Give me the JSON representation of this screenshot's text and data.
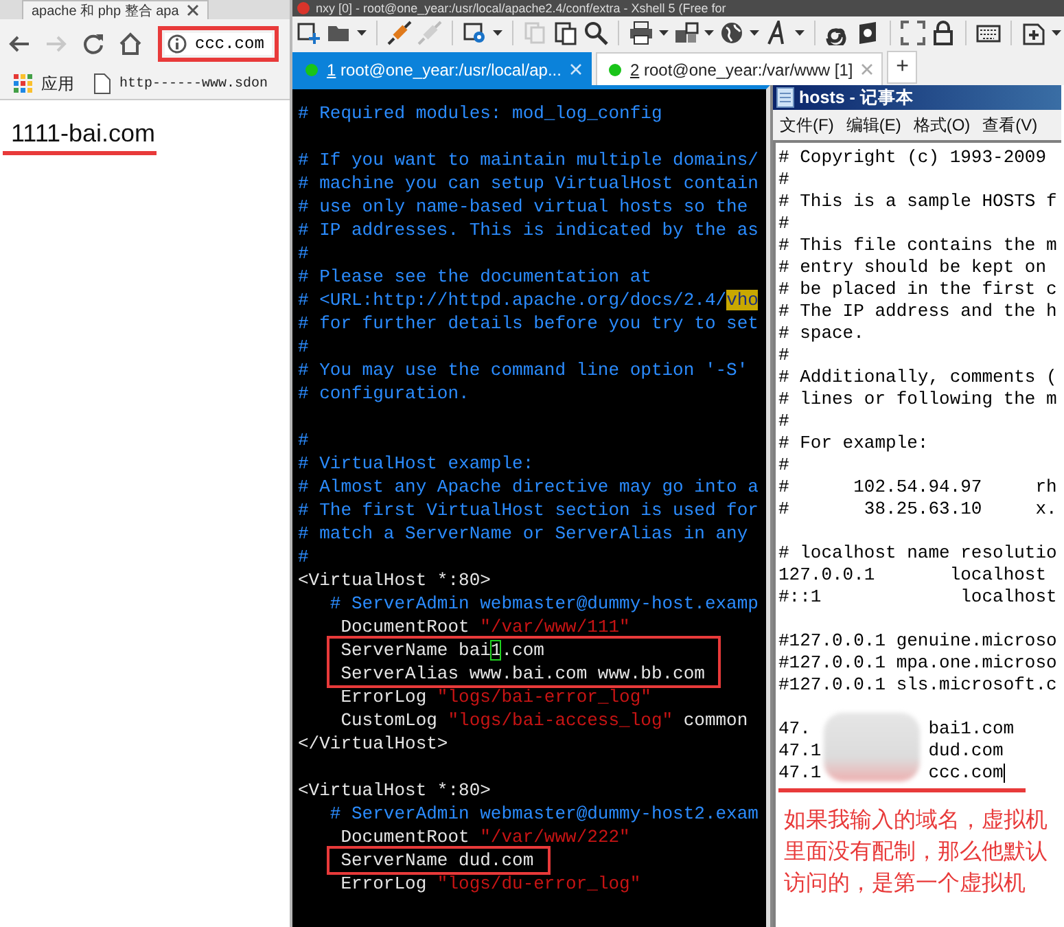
{
  "browser": {
    "tab": {
      "title": "apache 和 php 整合 apa"
    },
    "nav": [
      {
        "kind": "back",
        "disabled": false
      },
      {
        "kind": "forward",
        "disabled": true
      },
      {
        "kind": "reload",
        "disabled": false
      },
      {
        "kind": "home",
        "disabled": false
      }
    ],
    "address": {
      "value": "ccc.com"
    },
    "bookmarks": [
      {
        "kind": "apps",
        "label": "应用"
      },
      {
        "kind": "page",
        "label": "http------www.sdon"
      }
    ],
    "page_text": "1111-bai.com"
  },
  "xshell": {
    "title": "nxy [0] - root@one_year:/usr/local/apache2.4/conf/extra - Xshell 5 (Free for",
    "tabs": [
      {
        "number": "1",
        "label": " root@one_year:/usr/local/ap...",
        "selected": true
      },
      {
        "number": "2",
        "label": " root@one_year:/var/www [1]",
        "selected": false
      }
    ],
    "new_tab": "+",
    "terminal": {
      "lines": [
        {
          "kind": "text",
          "segments": [
            {
              "kind": "comment",
              "text": "# Required modules: mod_log_config"
            }
          ]
        },
        {
          "kind": "blank"
        },
        {
          "kind": "text",
          "segments": [
            {
              "kind": "comment",
              "text": "# If you want to maintain multiple domains/"
            }
          ]
        },
        {
          "kind": "text",
          "segments": [
            {
              "kind": "comment",
              "text": "# machine you can setup VirtualHost contain"
            }
          ]
        },
        {
          "kind": "text",
          "segments": [
            {
              "kind": "comment",
              "text": "# use only name-based virtual hosts so the"
            }
          ]
        },
        {
          "kind": "text",
          "segments": [
            {
              "kind": "comment",
              "text": "# IP addresses. This is indicated by the as"
            }
          ]
        },
        {
          "kind": "text",
          "segments": [
            {
              "kind": "comment",
              "text": "#"
            }
          ]
        },
        {
          "kind": "text",
          "segments": [
            {
              "kind": "comment",
              "text": "# Please see the documentation at"
            }
          ]
        },
        {
          "kind": "text",
          "segments": [
            {
              "kind": "comment",
              "text": "# <URL:http://httpd.apache.org/docs/2.4/"
            },
            {
              "kind": "match",
              "text": "vho"
            }
          ]
        },
        {
          "kind": "text",
          "segments": [
            {
              "kind": "comment",
              "text": "# for further details before you try to set"
            }
          ]
        },
        {
          "kind": "text",
          "segments": [
            {
              "kind": "comment",
              "text": "#"
            }
          ]
        },
        {
          "kind": "text",
          "segments": [
            {
              "kind": "comment",
              "text": "# You may use the command line option '-S'"
            }
          ]
        },
        {
          "kind": "text",
          "segments": [
            {
              "kind": "comment",
              "text": "# configuration."
            }
          ]
        },
        {
          "kind": "blank"
        },
        {
          "kind": "text",
          "segments": [
            {
              "kind": "comment",
              "text": "#"
            }
          ]
        },
        {
          "kind": "text",
          "segments": [
            {
              "kind": "comment",
              "text": "# VirtualHost example:"
            }
          ]
        },
        {
          "kind": "text",
          "segments": [
            {
              "kind": "comment",
              "text": "# Almost any Apache directive may go into a"
            }
          ]
        },
        {
          "kind": "text",
          "segments": [
            {
              "kind": "comment",
              "text": "# The first VirtualHost section is used for"
            }
          ]
        },
        {
          "kind": "text",
          "segments": [
            {
              "kind": "comment",
              "text": "# match a ServerName or ServerAlias in any"
            }
          ]
        },
        {
          "kind": "text",
          "segments": [
            {
              "kind": "comment",
              "text": "#"
            }
          ]
        },
        {
          "kind": "text",
          "segments": [
            {
              "kind": "code",
              "text": "<VirtualHost *:80>"
            }
          ]
        },
        {
          "kind": "text",
          "segments": [
            {
              "kind": "comment",
              "text": "   # ServerAdmin webmaster@dummy-host.examp"
            }
          ]
        },
        {
          "kind": "text",
          "segments": [
            {
              "kind": "code",
              "text": "    DocumentRoot "
            },
            {
              "kind": "string",
              "text": "\"/var/www/111\""
            }
          ]
        },
        {
          "kind": "boxed",
          "lines": [
            {
              "kind": "text",
              "segments": [
                {
                  "kind": "code",
                  "text": "    ServerName bai"
                },
                {
                  "kind": "cursor",
                  "text": "1"
                },
                {
                  "kind": "code",
                  "text": ".com"
                }
              ]
            },
            {
              "kind": "text",
              "segments": [
                {
                  "kind": "code",
                  "text": "    ServerAlias www.bai.com www.bb.com"
                }
              ]
            }
          ]
        },
        {
          "kind": "text",
          "segments": [
            {
              "kind": "code",
              "text": "    ErrorLog "
            },
            {
              "kind": "string",
              "text": "\"logs/bai-error_log\""
            }
          ]
        },
        {
          "kind": "text",
          "segments": [
            {
              "kind": "code",
              "text": "    CustomLog "
            },
            {
              "kind": "string",
              "text": "\"logs/bai-access_log\""
            },
            {
              "kind": "code",
              "text": " common"
            }
          ]
        },
        {
          "kind": "text",
          "segments": [
            {
              "kind": "code",
              "text": "</VirtualHost>"
            }
          ]
        },
        {
          "kind": "blank"
        },
        {
          "kind": "text",
          "segments": [
            {
              "kind": "code",
              "text": "<VirtualHost *:80>"
            }
          ]
        },
        {
          "kind": "text",
          "segments": [
            {
              "kind": "comment",
              "text": "   # ServerAdmin webmaster@dummy-host2.exam"
            }
          ]
        },
        {
          "kind": "text",
          "segments": [
            {
              "kind": "code",
              "text": "    DocumentRoot "
            },
            {
              "kind": "string",
              "text": "\"/var/www/222\""
            }
          ]
        },
        {
          "kind": "boxed",
          "lines": [
            {
              "kind": "text",
              "segments": [
                {
                  "kind": "code",
                  "text": "    ServerName dud.com"
                }
              ]
            }
          ]
        },
        {
          "kind": "text",
          "segments": [
            {
              "kind": "code",
              "text": "    ErrorLog "
            },
            {
              "kind": "string",
              "text": "\"logs/du-error_log\""
            }
          ]
        }
      ]
    }
  },
  "notepad": {
    "title": "hosts - 记事本",
    "menu": [
      "文件(F)",
      "编辑(E)",
      "格式(O)",
      "查看(V)"
    ],
    "lines": [
      {
        "kind": "text",
        "text": "# Copyright (c) 1993-2009"
      },
      {
        "kind": "text",
        "text": "#"
      },
      {
        "kind": "text",
        "text": "# This is a sample HOSTS f"
      },
      {
        "kind": "text",
        "text": "#"
      },
      {
        "kind": "text",
        "text": "# This file contains the m"
      },
      {
        "kind": "text",
        "text": "# entry should be kept on"
      },
      {
        "kind": "text",
        "text": "# be placed in the first c"
      },
      {
        "kind": "text",
        "text": "# The IP address and the h"
      },
      {
        "kind": "text",
        "text": "# space."
      },
      {
        "kind": "text",
        "text": "#"
      },
      {
        "kind": "text",
        "text": "# Additionally, comments ("
      },
      {
        "kind": "text",
        "text": "# lines or following the m"
      },
      {
        "kind": "text",
        "text": "#"
      },
      {
        "kind": "text",
        "text": "# For example:"
      },
      {
        "kind": "text",
        "text": "#"
      },
      {
        "kind": "text",
        "text": "#      102.54.94.97     rh"
      },
      {
        "kind": "text",
        "text": "#       38.25.63.10     x."
      },
      {
        "kind": "blank"
      },
      {
        "kind": "text",
        "text": "# localhost name resolutio"
      },
      {
        "kind": "text",
        "text": "127.0.0.1       localhost"
      },
      {
        "kind": "text",
        "text": "#::1             localhost"
      },
      {
        "kind": "blank"
      },
      {
        "kind": "text",
        "text": "#127.0.0.1 genuine.microso"
      },
      {
        "kind": "text",
        "text": "#127.0.0.1 mpa.one.microso"
      },
      {
        "kind": "text",
        "text": "#127.0.0.1 sls.microsoft.c"
      },
      {
        "kind": "blank"
      }
    ],
    "entries": [
      {
        "ip": "47.",
        "host": "bai1.com",
        "cursor": false
      },
      {
        "ip": "47.1",
        "host": "dud.com",
        "cursor": false
      },
      {
        "ip": "47.1",
        "host": "ccc.com",
        "cursor": true
      }
    ],
    "note": "如果我输入的域名，虚拟机里面没有配制，那么他默认访问的，是第一个虚拟机"
  }
}
